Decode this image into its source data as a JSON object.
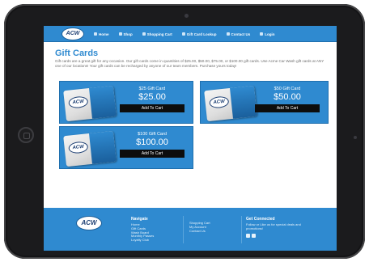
{
  "colors": {
    "accent": "#2f8ad0",
    "button": "#0d0d0d",
    "device": "#1b1b1d"
  },
  "logo_text": "ACW",
  "nav": {
    "items": [
      {
        "label": "Home",
        "icon": "home-icon"
      },
      {
        "label": "Shop",
        "icon": "shop-icon"
      },
      {
        "label": "Shopping Cart",
        "icon": "cart-icon"
      },
      {
        "label": "Gift Card Lookup",
        "icon": "gift-card-icon"
      },
      {
        "label": "Contact Us",
        "icon": "contact-icon"
      },
      {
        "label": "Login",
        "icon": "login-icon"
      }
    ]
  },
  "page": {
    "title": "Gift Cards",
    "intro": "Gift cards are a great gift for any occasion. Our gift cards come in quantities of $25.00, $50.00, $75.00, or $100.00 gift cards. Use Acme Car Wash gift cards at ANY one of our locations! Your gift cards can be recharged by anyone of our team members. Purchase yours today!"
  },
  "cards": [
    {
      "name": "$25 Gift Card",
      "price": "$25.00",
      "button": "Add To Cart"
    },
    {
      "name": "$50 Gift Card",
      "price": "$50.00",
      "button": "Add To Cart"
    },
    {
      "name": "$100 Gift Card",
      "price": "$100.00",
      "button": "Add To Cart"
    }
  ],
  "footer": {
    "navigate_heading": "Navigate",
    "navigate_links": [
      "Home",
      "Gift Cards",
      "Wash Board",
      "Monthly Passes",
      "Loyalty Club"
    ],
    "links2": [
      "Shopping Cart",
      "My Account",
      "Contact Us"
    ],
    "connect_heading": "Get Connected",
    "connect_text": "Follow or Like us for special deals and promotions!"
  }
}
